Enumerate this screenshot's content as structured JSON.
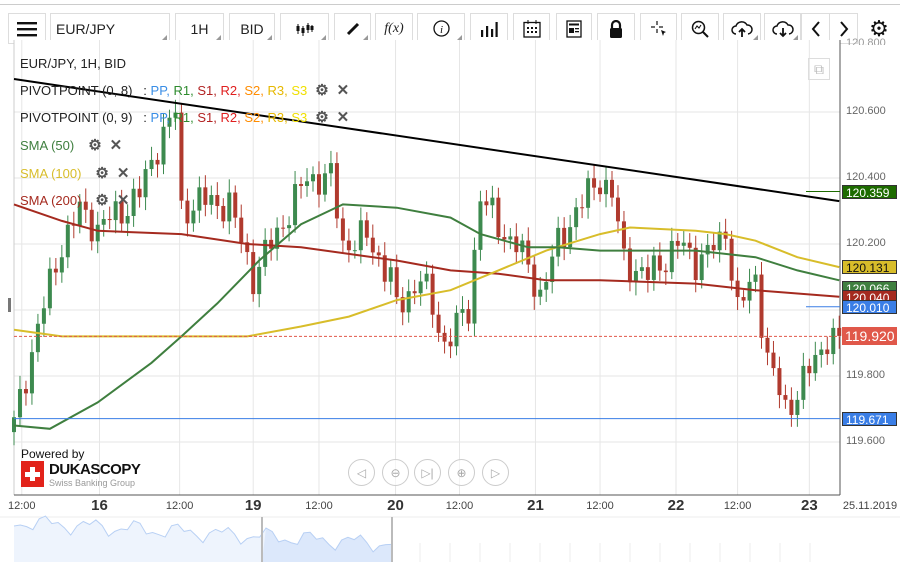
{
  "toolbar": {
    "menu_icon": "hamburger-icon",
    "symbol": "EUR/JPY",
    "timeframe": "1H",
    "price_side": "BID",
    "fx_label": "f(x)",
    "icons": [
      "candlestick-icon",
      "pencil-icon",
      "function-icon",
      "info-icon",
      "volume-bars-icon",
      "calendar-icon",
      "news-icon",
      "lock-icon",
      "crosshair-icon",
      "zoom-chart-icon",
      "upload-cloud-icon",
      "download-cloud-icon",
      "chevron-left-icon",
      "chevron-right-icon",
      "gear-icon"
    ]
  },
  "legend": {
    "title": "EUR/JPY, 1H, BID",
    "pivot1": {
      "name": "PIVOTPOINT (0, 8)",
      "sep": ":",
      "pp": "PP,",
      "r1": "R1,",
      "s1": "S1,",
      "r2": "R2,",
      "s2": "S2,",
      "r3": "R3,",
      "s3": "S3"
    },
    "pivot2": {
      "name": "PIVOTPOINT (0, 9)",
      "sep": ":",
      "pp": "PP,",
      "r1": "R1,",
      "s1": "S1,",
      "r2": "R2,",
      "s2": "S2,",
      "r3": "R3,",
      "s3": "S3"
    },
    "sma50": "SMA (50)",
    "sma100": "SMA (100)",
    "sma200": "SMA (200)"
  },
  "branding": {
    "powered_by": "Powered by",
    "logo": "DUKASCOPY",
    "tagline": "Swiss Banking Group"
  },
  "colors": {
    "up": "#3d8a4f",
    "down": "#b03a2e",
    "sma50": "#3f7f3f",
    "sma100": "#d8bd2a",
    "sma200": "#a52a1f",
    "trend": "#000000",
    "blue": "#3a7ee6",
    "current": "#e0584a"
  },
  "chart_data": {
    "type": "candlestick",
    "symbol": "EUR/JPY",
    "timeframe": "1H",
    "ylim": [
      119.55,
      120.8
    ],
    "y_ticks": [
      "120.600",
      "120.400",
      "120.200",
      "120.000",
      "119.800",
      "119.600"
    ],
    "y_tick_values": [
      120.6,
      120.4,
      120.2,
      120.0,
      119.8,
      119.6
    ],
    "x_ticks": [
      {
        "h": 1.3,
        "label": "12:00",
        "day": false
      },
      {
        "h": 14.3,
        "label": "16",
        "day": true
      },
      {
        "h": 27.7,
        "label": "12:00",
        "day": false
      },
      {
        "h": 40,
        "label": "19",
        "day": true
      },
      {
        "h": 51,
        "label": "12:00",
        "day": false
      },
      {
        "h": 63.8,
        "label": "20",
        "day": true
      },
      {
        "h": 74.5,
        "label": "12:00",
        "day": false
      },
      {
        "h": 87.2,
        "label": "21",
        "day": true
      },
      {
        "h": 98,
        "label": "12:00",
        "day": false
      },
      {
        "h": 110.7,
        "label": "22",
        "day": true
      },
      {
        "h": 121,
        "label": "12:00",
        "day": false
      },
      {
        "h": 133,
        "label": "23",
        "day": true
      }
    ],
    "date_label": "25.11.2019",
    "close_path": [
      [
        0,
        119.65
      ],
      [
        4,
        119.95
      ],
      [
        8,
        120.2
      ],
      [
        11,
        120.3
      ],
      [
        14,
        120.25
      ],
      [
        18,
        120.3
      ],
      [
        21,
        120.35
      ],
      [
        24,
        120.5
      ],
      [
        27,
        120.6
      ],
      [
        28,
        120.3
      ],
      [
        31,
        120.33
      ],
      [
        36,
        120.32
      ],
      [
        40,
        120.1
      ],
      [
        43,
        120.2
      ],
      [
        46,
        120.3
      ],
      [
        49,
        120.4
      ],
      [
        53,
        120.4
      ],
      [
        55,
        120.2
      ],
      [
        59,
        120.22
      ],
      [
        63,
        120.1
      ],
      [
        64,
        120.0
      ],
      [
        68,
        120.1
      ],
      [
        72,
        119.9
      ],
      [
        74,
        119.95
      ],
      [
        76,
        120.0
      ],
      [
        78,
        120.35
      ],
      [
        81,
        120.25
      ],
      [
        84,
        120.2
      ],
      [
        88,
        120.05
      ],
      [
        91,
        120.2
      ],
      [
        94,
        120.3
      ],
      [
        98,
        120.4
      ],
      [
        100,
        120.35
      ],
      [
        102,
        120.15
      ],
      [
        106,
        120.1
      ],
      [
        111,
        120.2
      ],
      [
        114,
        120.15
      ],
      [
        118,
        120.2
      ],
      [
        119,
        120.25
      ],
      [
        121,
        120.0
      ],
      [
        124,
        120.1
      ],
      [
        126,
        119.85
      ],
      [
        129,
        119.7
      ],
      [
        131,
        119.75
      ],
      [
        134,
        119.85
      ],
      [
        136,
        119.92
      ],
      [
        138,
        119.9
      ]
    ],
    "sma50": [
      [
        0,
        119.65
      ],
      [
        6,
        119.64
      ],
      [
        14,
        119.72
      ],
      [
        23,
        119.84
      ],
      [
        28,
        119.92
      ],
      [
        34,
        120.02
      ],
      [
        41,
        120.15
      ],
      [
        48,
        120.26
      ],
      [
        55,
        120.32
      ],
      [
        64,
        120.31
      ],
      [
        73,
        120.28
      ],
      [
        78,
        120.23
      ],
      [
        86,
        120.19
      ],
      [
        91,
        120.19
      ],
      [
        98,
        120.18
      ],
      [
        114,
        120.18
      ],
      [
        124,
        120.16
      ],
      [
        131,
        120.12
      ],
      [
        138,
        120.09
      ]
    ],
    "sma100": [
      [
        0,
        119.94
      ],
      [
        8,
        119.92
      ],
      [
        23,
        119.92
      ],
      [
        39,
        119.92
      ],
      [
        48,
        119.95
      ],
      [
        56,
        119.98
      ],
      [
        64,
        120.03
      ],
      [
        73,
        120.06
      ],
      [
        81,
        120.12
      ],
      [
        89,
        120.18
      ],
      [
        98,
        120.23
      ],
      [
        103,
        120.25
      ],
      [
        114,
        120.24
      ],
      [
        119,
        120.23
      ],
      [
        124,
        120.21
      ],
      [
        131,
        120.16
      ],
      [
        138,
        120.13
      ]
    ],
    "sma200": [
      [
        0,
        120.32
      ],
      [
        8,
        120.27
      ],
      [
        14,
        120.24
      ],
      [
        28,
        120.23
      ],
      [
        39,
        120.2
      ],
      [
        48,
        120.19
      ],
      [
        64,
        120.15
      ],
      [
        73,
        120.12
      ],
      [
        81,
        120.11
      ],
      [
        89,
        120.09
      ],
      [
        98,
        120.09
      ],
      [
        114,
        120.08
      ],
      [
        124,
        120.06
      ],
      [
        138,
        120.04
      ]
    ],
    "trendline": [
      [
        0,
        120.7
      ],
      [
        138,
        120.33
      ]
    ],
    "levels": [
      {
        "value": 120.359,
        "label": "120.359",
        "color": "#1d6b00",
        "kind": "short"
      },
      {
        "value": 120.131,
        "label": "120.131",
        "color": "#d8bd2a",
        "kind": "none"
      },
      {
        "value": 120.066,
        "label": "120.066",
        "color": "#3f7f3f",
        "kind": "none"
      },
      {
        "value": 120.04,
        "label": "120.040",
        "color": "#a52a1f",
        "kind": "none"
      },
      {
        "value": 120.01,
        "label": "120.010",
        "color": "#3a7ee6",
        "kind": "short"
      },
      {
        "value": 119.92,
        "label": "119.920",
        "color": "#e0584a",
        "kind": "dashed"
      },
      {
        "value": 119.671,
        "label": "119.671",
        "color": "#3a7ee6",
        "kind": "full"
      }
    ],
    "current_price": 119.92
  }
}
